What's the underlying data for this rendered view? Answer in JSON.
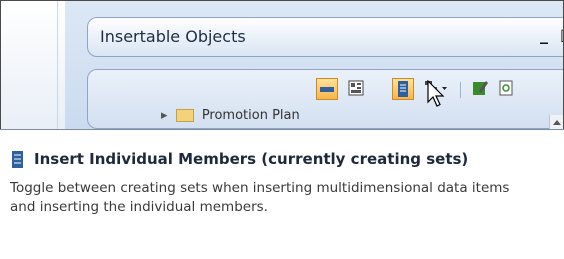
{
  "window": {
    "title": "Insertable Objects",
    "minimize_glyph": "_",
    "maximize_glyph": "□"
  },
  "toolbar": {
    "buttons": [
      {
        "name": "insert-sets-icon",
        "active": true
      },
      {
        "name": "table-layout-icon",
        "active": false
      },
      {
        "name": "insert-individual-members-icon",
        "active": true
      },
      {
        "name": "tree-view-icon",
        "active": false
      },
      {
        "name": "edit-icon",
        "active": false
      },
      {
        "name": "refresh-icon",
        "active": false
      }
    ]
  },
  "tree": {
    "item_label": "Promotion Plan"
  },
  "tooltip": {
    "title": "Insert Individual Members (currently creating sets)",
    "body": "Toggle between creating sets when inserting multidimensional data items and inserting the individual members."
  },
  "colors": {
    "active_button": "#f6b54b",
    "panel_border": "#8ea6c6",
    "icon_blue": "#2f5f9f"
  }
}
